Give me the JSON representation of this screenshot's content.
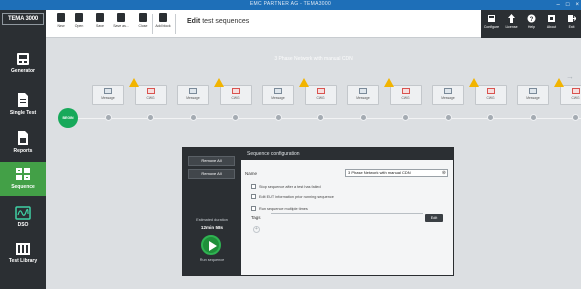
{
  "window": {
    "title": "EMC PARTNER AG - TEMA3000",
    "controls": [
      "–",
      "□",
      "×"
    ]
  },
  "sidebar": {
    "brand": "TEMA 3000",
    "items": [
      {
        "label": "Generator",
        "icon": "generator-icon"
      },
      {
        "label": "Single Test",
        "icon": "document-icon"
      },
      {
        "label": "Reports",
        "icon": "report-icon"
      },
      {
        "label": "Sequence",
        "icon": "sequence-icon",
        "active": true
      },
      {
        "label": "DSO",
        "icon": "waveform-icon"
      },
      {
        "label": "Test Library",
        "icon": "library-icon"
      }
    ]
  },
  "toolbar": {
    "buttons": [
      {
        "label": "New"
      },
      {
        "label": "Open"
      },
      {
        "label": "Save"
      },
      {
        "label": "Save as..."
      },
      {
        "label": "Close"
      },
      {
        "label": "Add block"
      }
    ],
    "title_action": "Edit",
    "title_object": "test sequences",
    "right_buttons": [
      {
        "label": "Configure"
      },
      {
        "label": "License"
      },
      {
        "label": "Help"
      },
      {
        "label": "About"
      },
      {
        "label": "Exit"
      }
    ]
  },
  "canvas": {
    "sequence_name": "3 Phase Network with manual CDN",
    "begin_label": "BEGIN",
    "nodes": [
      "Message",
      "CWG",
      "Message",
      "CWG",
      "Message",
      "CWG",
      "Message",
      "CWG",
      "Message",
      "CWG",
      "Message",
      "CWG"
    ],
    "warning_color": "#f2b400"
  },
  "dialog": {
    "remove_all_1": "Remove All",
    "remove_all_2": "Remove All",
    "header": "Sequence configuration",
    "name_label": "Name",
    "name_value": "3 Phase Network with manual CDN",
    "options": [
      "Stop sequence after a test has failed",
      "Edit EUT information prior running sequence",
      "Run sequence multiple times"
    ],
    "tags_label": "Tags",
    "edit_label": "Edit",
    "estimated_duration_label": "Estimated duration",
    "estimated_duration_value": "12min 58s",
    "run_label": "Run sequence"
  },
  "colors": {
    "accent_green": "#43a047",
    "titlebar_blue": "#1e6fb8",
    "dark_panel": "#2b2f33"
  }
}
